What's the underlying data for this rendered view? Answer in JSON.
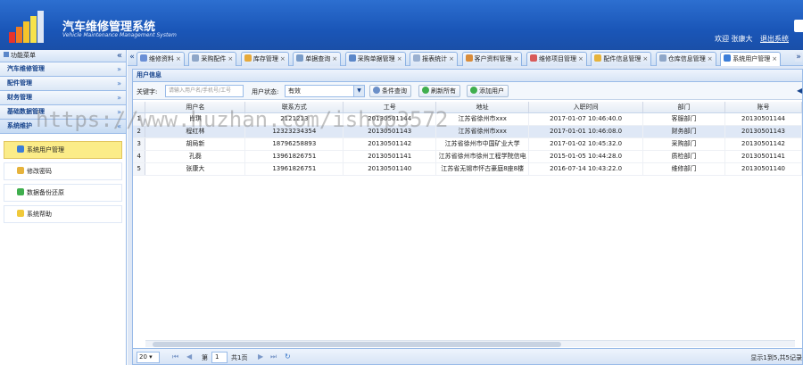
{
  "header": {
    "title": "汽车维修管理系统",
    "subtitle": "Vehicle Maintenance Management System",
    "welcome": "欢迎 张康大",
    "logout": "退出系统"
  },
  "sidebar": {
    "title": "功能菜单",
    "collapse": "«",
    "sections": [
      {
        "label": "汽车维修管理"
      },
      {
        "label": "配件管理"
      },
      {
        "label": "财务管理"
      },
      {
        "label": "基础数据管理"
      },
      {
        "label": "系统维护"
      }
    ],
    "items": [
      {
        "label": "系统用户管理",
        "icon": "user-icon"
      },
      {
        "label": "修改密码",
        "icon": "pencil-icon"
      },
      {
        "label": "数据备份还原",
        "icon": "refresh-icon"
      },
      {
        "label": "系统帮助",
        "icon": "lightbulb-icon"
      }
    ]
  },
  "tabs": {
    "scroll_left": "«",
    "scroll_right": "»",
    "items": [
      {
        "label": "维修资料"
      },
      {
        "label": "采购配件"
      },
      {
        "label": "库存管理"
      },
      {
        "label": "单据查询"
      },
      {
        "label": "采购单据管理"
      },
      {
        "label": "报表统计"
      },
      {
        "label": "客户资料管理"
      },
      {
        "label": "维修项目管理"
      },
      {
        "label": "配件信息管理"
      },
      {
        "label": "仓库信息管理"
      },
      {
        "label": "系统用户管理"
      }
    ],
    "close": "×"
  },
  "panel": {
    "title": "用户信息"
  },
  "toolbar": {
    "keyword_label": "关键字:",
    "keyword_placeholder": "请输入用户名/手机号/工号",
    "status_label": "用户状态:",
    "status_value": "有效",
    "search_label": "条件查询",
    "refresh_label": "刷新所有",
    "add_label": "添加用户"
  },
  "table": {
    "columns": [
      "",
      "用户名",
      "联系方式",
      "工号",
      "地址",
      "入职时间",
      "部门",
      "账号"
    ],
    "rows": [
      [
        "1",
        "肖琪",
        "2121213",
        "20130501144",
        "江苏省徐州市xxx",
        "2017-01-07 10:46:40.0",
        "客服部门",
        "20130501144"
      ],
      [
        "2",
        "程红林",
        "12323234354",
        "20130501143",
        "江苏省徐州市xxx",
        "2017-01-01 10:46:08.0",
        "财务部门",
        "20130501143"
      ],
      [
        "3",
        "胡局新",
        "18796258893",
        "20130501142",
        "江苏省徐州市中国矿业大学",
        "2017-01-02 10:45:32.0",
        "采购部门",
        "20130501142"
      ],
      [
        "4",
        "孔磊",
        "13961826751",
        "20130501141",
        "江苏省徐州市徐州工程学院信电",
        "2015-01-05 10:44:28.0",
        "质检部门",
        "20130501141"
      ],
      [
        "5",
        "张康大",
        "13961826751",
        "20130501140",
        "江苏省无锡市怀古豪庭8座8楼",
        "2016-07-14 10:43:22.0",
        "维修部门",
        "20130501140"
      ]
    ]
  },
  "pager": {
    "page_size": "20",
    "page_prefix": "第",
    "page_value": "1",
    "page_suffix": "共1页",
    "info": "显示1到5,共5记录"
  },
  "watermark": "https://www.huzhan.com/ishop3572",
  "colors": {
    "header": "#1a56b8",
    "panel_border": "#99bbe8",
    "selected_menu": "#fbec88"
  }
}
